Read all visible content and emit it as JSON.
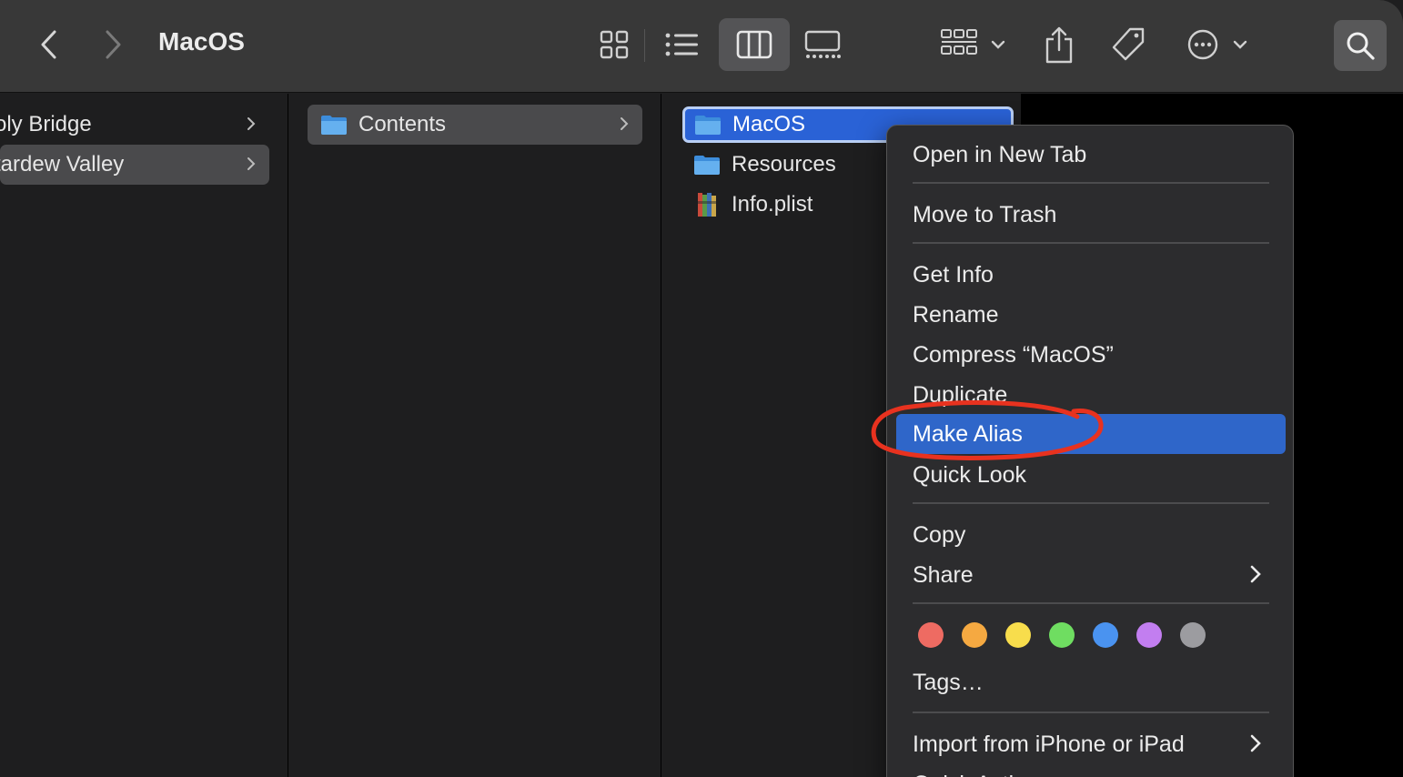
{
  "toolbar": {
    "title": "MacOS",
    "buttons": {
      "back": "chevron-left-icon",
      "forward": "chevron-right-icon",
      "icon_view": "grid-icon",
      "list_view": "list-icon",
      "column_view": "columns-icon",
      "gallery_view": "gallery-icon",
      "group": "group-icon",
      "share": "share-icon",
      "tag": "tag-icon",
      "more": "ellipsis-circle-icon",
      "search": "search-icon"
    }
  },
  "columns": {
    "col1": [
      "oly Bridge",
      "tardew Valley"
    ],
    "col2": [
      "Contents"
    ],
    "col3": [
      "MacOS",
      "Resources",
      "Info.plist"
    ]
  },
  "context_menu": {
    "items": [
      "Open in New Tab",
      "Move to Trash",
      "Get Info",
      "Rename",
      "Compress “MacOS”",
      "Duplicate",
      "Make Alias",
      "Quick Look",
      "Copy",
      "Share",
      "Tags…",
      "Import from iPhone or iPad",
      "Quick Actions"
    ],
    "highlighted": "Make Alias",
    "tag_colors": [
      "#ee6b62",
      "#f5a941",
      "#f8dd4c",
      "#6fdd61",
      "#4a93f0",
      "#c27ef0",
      "#9c9ca0"
    ]
  },
  "colors": {
    "selection": "#2a62d6",
    "menu_highlight": "#2f66c9",
    "annotation": "#e8321f"
  }
}
